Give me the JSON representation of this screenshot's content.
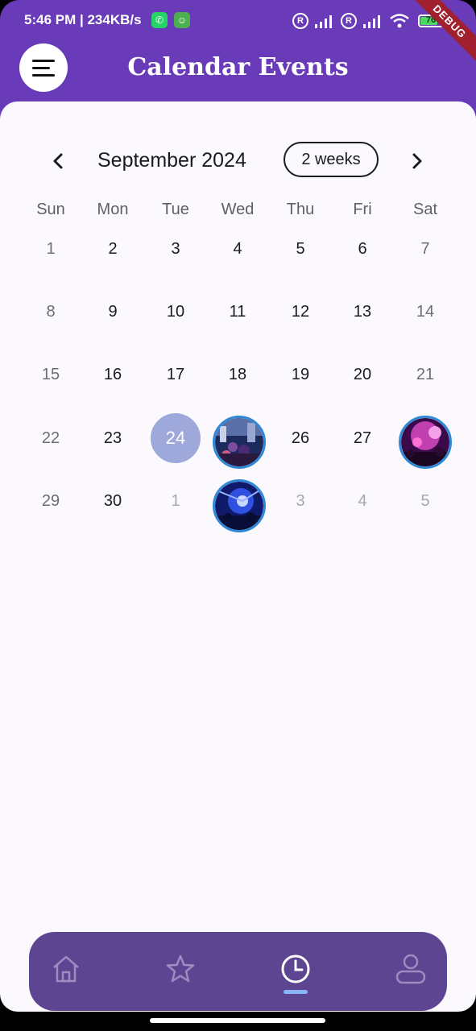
{
  "status_bar": {
    "time_speed": "5:46 PM | 234KB/s",
    "registered_mark": "R",
    "battery": "76"
  },
  "debug_banner": "DEBUG",
  "app_bar": {
    "title": "Calendar Events",
    "menu_icon": "menu-icon"
  },
  "calendar": {
    "month_label": "September 2024",
    "format_button": "2 weeks",
    "days_of_week": [
      "Sun",
      "Mon",
      "Tue",
      "Wed",
      "Thu",
      "Fri",
      "Sat"
    ],
    "weeks": [
      [
        "1",
        "2",
        "3",
        "4",
        "5",
        "6",
        "7"
      ],
      [
        "8",
        "9",
        "10",
        "11",
        "12",
        "13",
        "14"
      ],
      [
        "15",
        "16",
        "17",
        "18",
        "19",
        "20",
        "21"
      ],
      [
        "22",
        "23",
        "24",
        "25",
        "26",
        "27",
        "28"
      ],
      [
        "29",
        "30",
        "1",
        "2",
        "3",
        "4",
        "5"
      ]
    ],
    "today": "24",
    "event_days": [
      "25",
      "28",
      "2 (October)"
    ],
    "colors": {
      "today": "#9fa8da",
      "event_ring": "#2f87d6",
      "app_bar": "#6a3bb8",
      "bottom_nav": "#5e4591"
    }
  },
  "bottom_nav": {
    "items": [
      "home-icon",
      "star-icon",
      "clock-icon",
      "profile-icon"
    ],
    "selected": "clock-icon"
  }
}
